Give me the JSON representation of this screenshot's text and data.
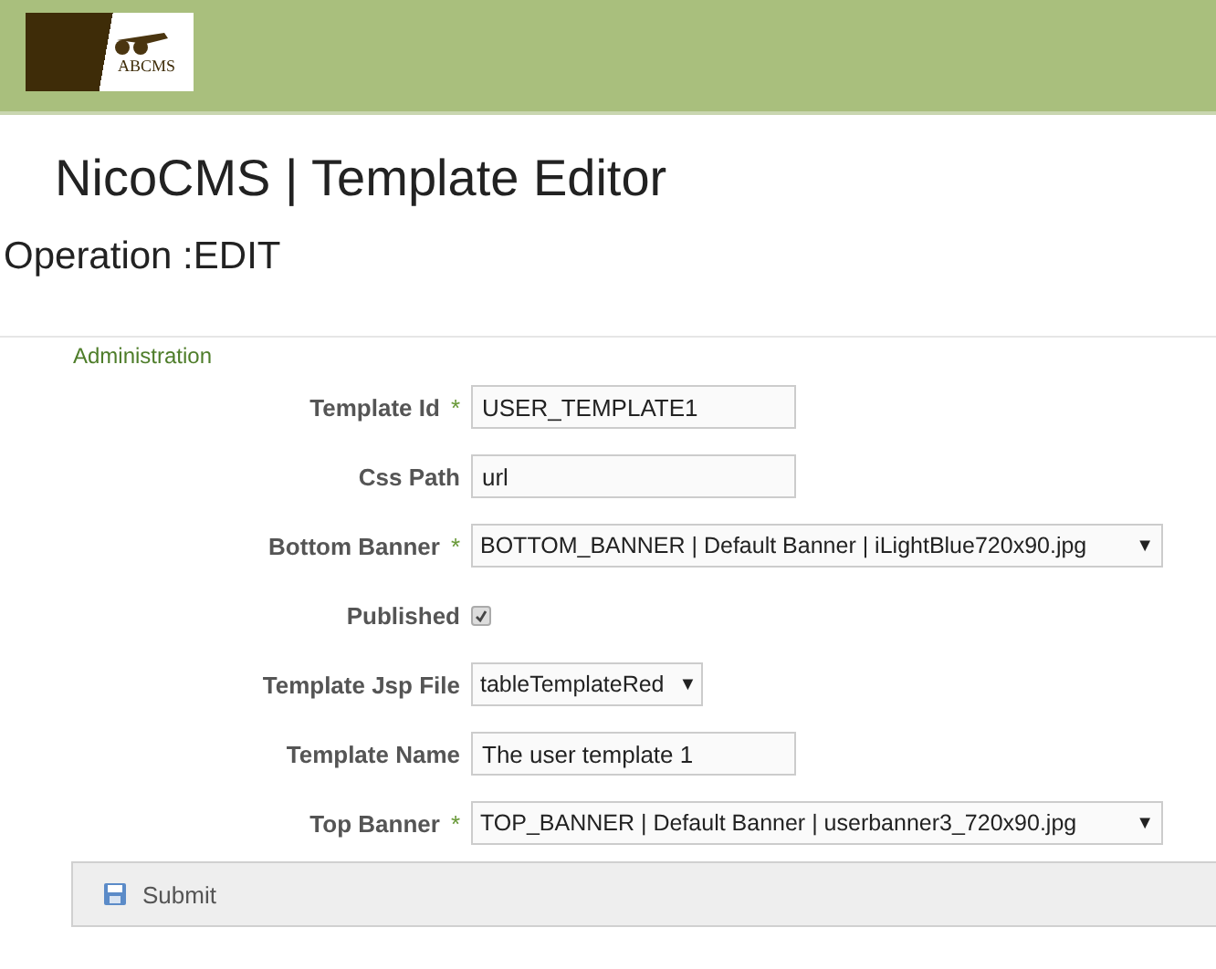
{
  "header": {
    "logo": {
      "text": "ABCMS"
    }
  },
  "title": "NicoCMS | Template Editor",
  "operation": "Operation :EDIT",
  "section": "Administration",
  "fields": [
    {
      "kind": "text",
      "label": "Template Id",
      "required_mark": "*",
      "value": "USER_TEMPLATE1"
    },
    {
      "kind": "text",
      "label": "Css Path",
      "value": "url"
    },
    {
      "kind": "select",
      "label": "Bottom Banner",
      "required_mark": "*",
      "value": "BOTTOM_BANNER | Default Banner | iLightBlue720x90.jpg",
      "arrow": "▼"
    },
    {
      "kind": "checkbox",
      "label": "Published",
      "checked": true
    },
    {
      "kind": "smallselect",
      "label": "Template Jsp File",
      "value": "tableTemplateRed",
      "arrow": "▼"
    },
    {
      "kind": "text",
      "label": "Template Name",
      "value": "The user template 1"
    },
    {
      "kind": "select",
      "label": "Top Banner",
      "required_mark": "*",
      "value": "TOP_BANNER | Default Banner | userbanner3_720x90.jpg",
      "arrow": "▼"
    }
  ],
  "submit": {
    "label": "Submit"
  }
}
